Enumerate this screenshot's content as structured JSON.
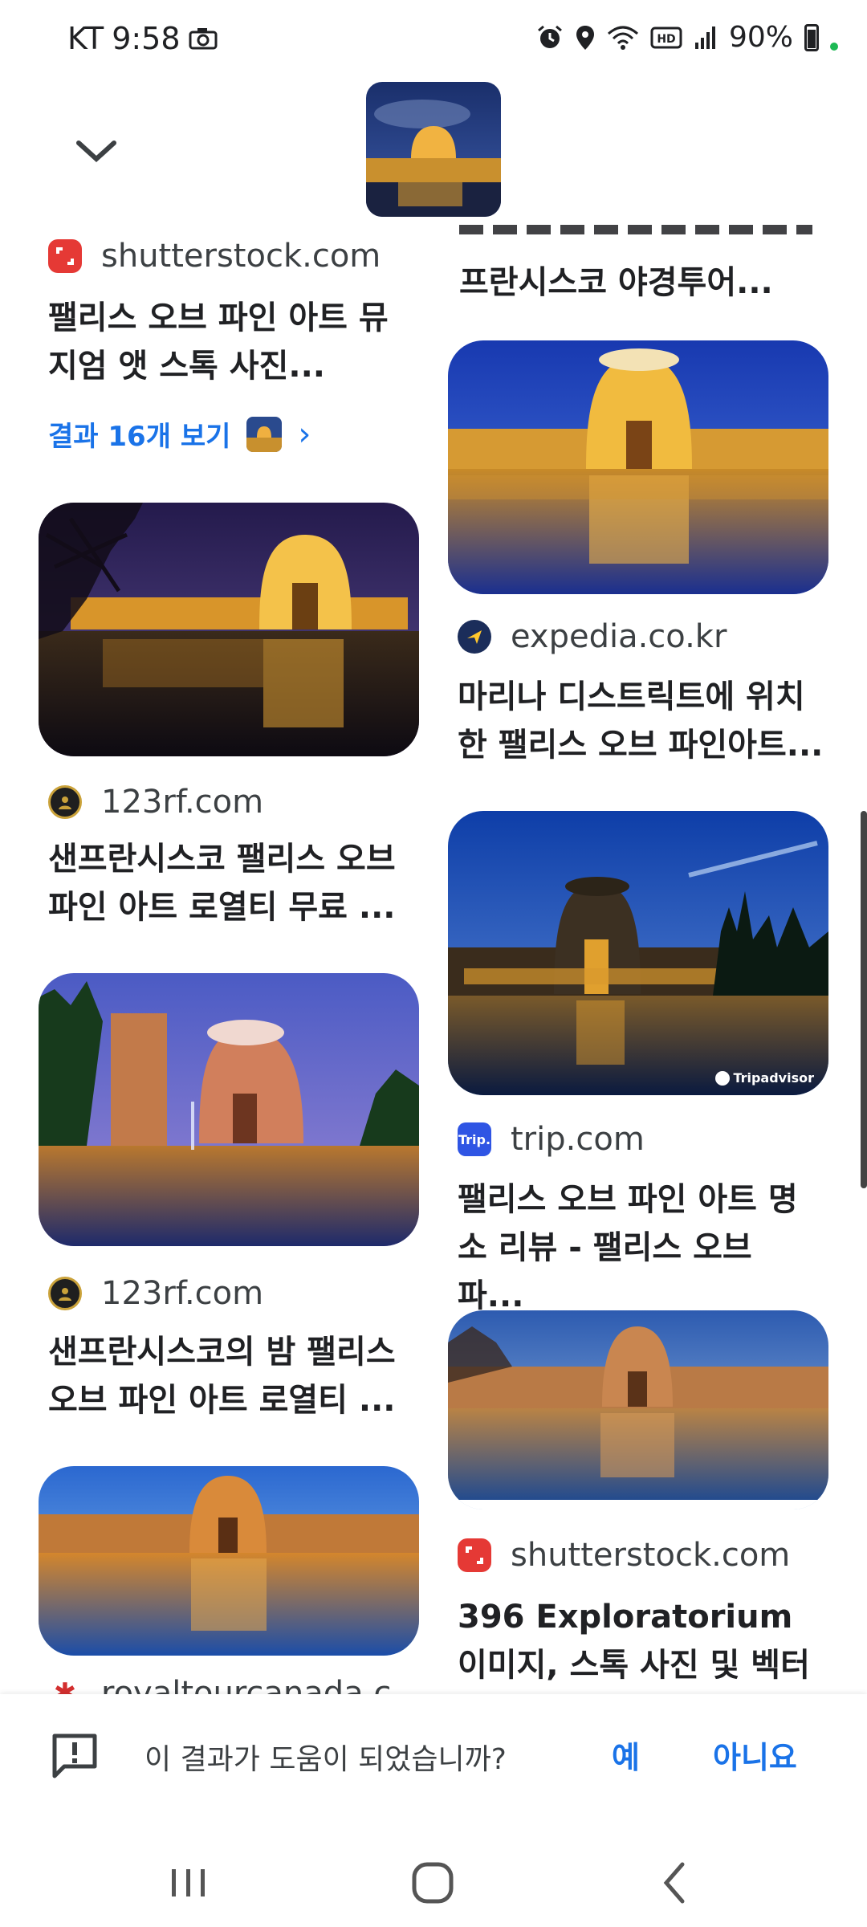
{
  "status_bar": {
    "carrier": "KT",
    "time": "9:58",
    "battery": "90%",
    "icons": [
      "camera-icon",
      "alarm-icon",
      "location-icon",
      "wifi-icon",
      "hd-icon",
      "signal-icon",
      "battery-icon"
    ]
  },
  "header": {
    "collapse_icon": "chevron-down-icon",
    "thumb_alt": "Palace of Fine Arts at night"
  },
  "left_column": {
    "top_result": {
      "source": "shutterstock.com",
      "title": "팰리스 오브 파인 아트 뮤지엄 앳 스톡 사진...",
      "more_label": "결과 16개 보기"
    },
    "cards": [
      {
        "source": "123rf.com",
        "title": "샌프란시스코 팰리스 오브 파인 아트 로열티 무료 ..."
      },
      {
        "source": "123rf.com",
        "title": "샌프란시스코의 밤 팰리스 오브 파인 아트 로열티 ..."
      },
      {
        "source": "royaltourcanada.c",
        "title": ""
      }
    ]
  },
  "right_column": {
    "partial_title": "프란시스코 야경투어...",
    "cards": [
      {
        "source": "expedia.co.kr",
        "title": "마리나 디스트릭트에 위치한 팰리스 오브 파인아트..."
      },
      {
        "source": "trip.com",
        "title": "팰리스 오브 파인 아트 명소 리뷰 - 팰리스 오브 파...",
        "watermark": "Tripadvisor"
      },
      {
        "source": "shutterstock.com",
        "title": "396 Exploratorium 이미지, 스톡 사진 및 벡터 ..."
      }
    ]
  },
  "feedback": {
    "question": "이 결과가 도움이 되었습니까?",
    "yes": "예",
    "no": "아니요"
  },
  "navbar": {
    "icons": [
      "recent-apps-icon",
      "home-icon",
      "back-icon"
    ]
  },
  "colors": {
    "link_blue": "#1a73e8",
    "text_primary": "#202124",
    "text_secondary": "#3c4043"
  }
}
